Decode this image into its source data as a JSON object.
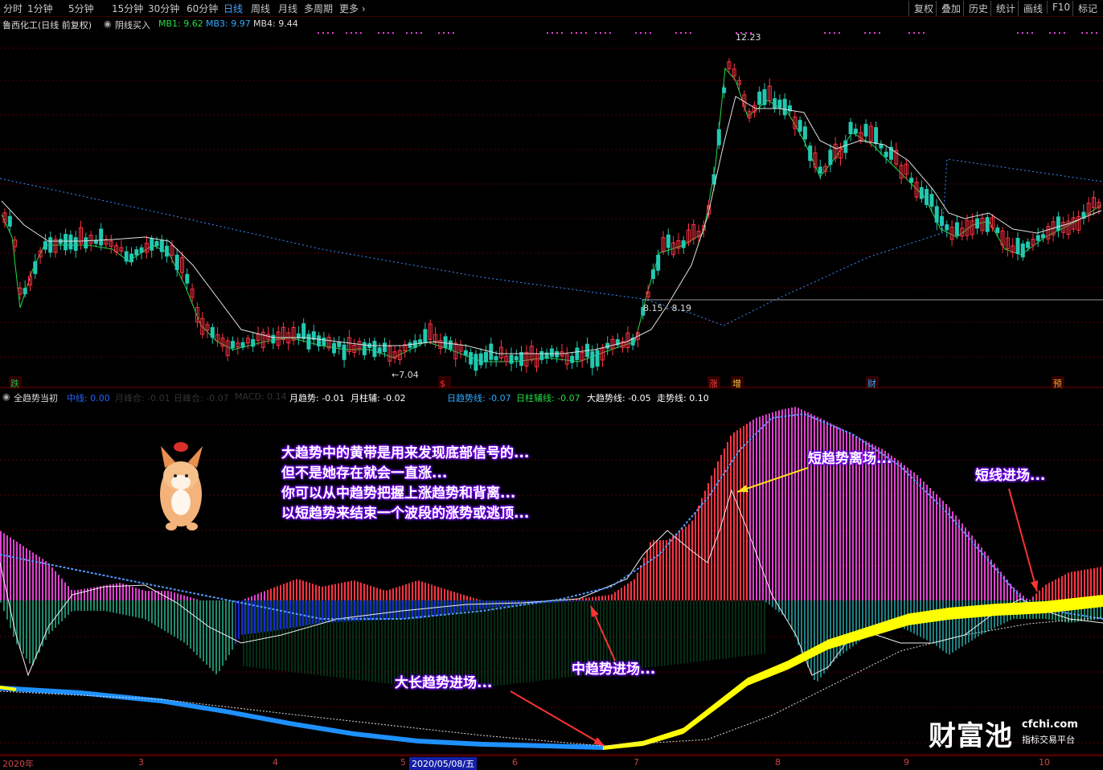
{
  "toolbar": {
    "periods": [
      "分时",
      "1分钟",
      "5分钟",
      "15分钟",
      "30分钟",
      "60分钟",
      "日线",
      "周线",
      "月线",
      "多周期",
      "更多"
    ],
    "active_period": "日线",
    "right_buttons": [
      "复权",
      "叠加",
      "历史",
      "统计",
      "画线",
      "F10",
      "标记"
    ]
  },
  "main_panel": {
    "title": "鲁西化工(日线 前复权)",
    "indicator": "阴线买入",
    "mb1": "MB1: 9.62",
    "mb3": "MB3: 9.97",
    "mb4": "MB4: 9.44",
    "high_label": "12.23",
    "low_label": "7.04",
    "range_label": "8.15 - 8.19",
    "flags": [
      {
        "text": "跌",
        "color": "#22bb44"
      },
      {
        "text": "$",
        "color": "#ff3333"
      },
      {
        "text": "涨",
        "color": "#ff4444"
      },
      {
        "text": "增",
        "color": "#ffcc33"
      },
      {
        "text": "财",
        "color": "#33aaff"
      },
      {
        "text": "预",
        "color": "#ffaa33"
      }
    ]
  },
  "sub_panel": {
    "title": "全趋势当初",
    "legend": [
      {
        "label": "中线: 0.00",
        "color": "#2266ff"
      },
      {
        "label": "月峰合: -0.01",
        "color": "#333333"
      },
      {
        "label": "日峰合: -0.07",
        "color": "#333333"
      },
      {
        "label": "MACD: 0.14",
        "color": "#333333"
      },
      {
        "label": "月趋势: -0.01",
        "color": "#ffffff"
      },
      {
        "label": "月柱辅: -0.02",
        "color": "#ffffff"
      },
      {
        "label": "日趋势线: -0.07",
        "color": "#33aaff"
      },
      {
        "label": "日柱辅线: -0.07",
        "color": "#22dd44"
      },
      {
        "label": "大趋势线: -0.05",
        "color": "#ffffff"
      },
      {
        "label": "走势线: 0.10",
        "color": "#ffffff"
      }
    ],
    "annotations": {
      "main_text": [
        "大趋势中的黄带是用来发现底部信号的...",
        "但不是她存在就会一直涨...",
        "你可以从中趋势把握上涨趋势和背离...",
        "以短趋势来结束一个波段的涨势或逃顶..."
      ],
      "short_exit": "短趋势离场...",
      "short_entry": "短线进场...",
      "mid_entry": "中趋势进场...",
      "long_entry": "大长趋势进场..."
    }
  },
  "axis": {
    "months": [
      "2020年",
      "3",
      "4",
      "5",
      "6",
      "7",
      "8",
      "9",
      "10"
    ],
    "selected_date": "2020/05/08/五"
  },
  "logo": {
    "brand": "财富池",
    "domain": "cfchi.com",
    "tagline": "指标交易平台"
  },
  "colors": {
    "up": "#ff3344",
    "down": "#22c8b0",
    "magenta": "#e040d0",
    "blue_bar": "#1a2ad0",
    "yellow_band": "#ffff00",
    "blue_band": "#1e90ff",
    "grid": "#5a0000"
  }
}
